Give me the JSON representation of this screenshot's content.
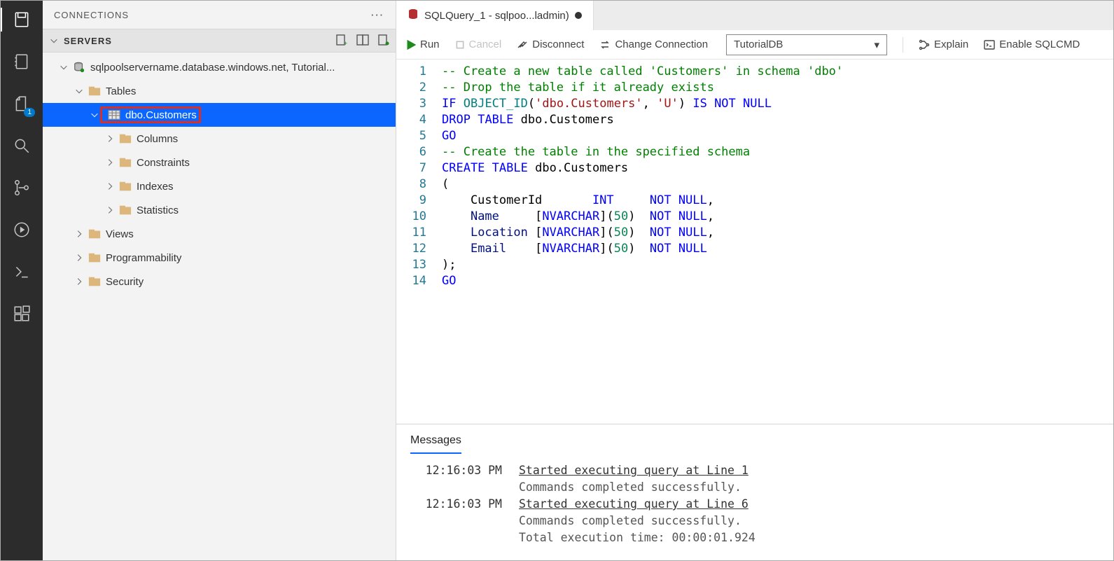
{
  "sidebar": {
    "title": "CONNECTIONS",
    "servers_label": "SERVERS",
    "tree": {
      "server": "sqlpoolservername.database.windows.net, Tutorial...",
      "tables": "Tables",
      "dbo_customers": "dbo.Customers",
      "columns": "Columns",
      "constraints": "Constraints",
      "indexes": "Indexes",
      "statistics": "Statistics",
      "views": "Views",
      "programmability": "Programmability",
      "security": "Security"
    }
  },
  "activity_badge": "1",
  "tab": {
    "title": "SQLQuery_1 - sqlpoo...ladmin)"
  },
  "toolbar": {
    "run": "Run",
    "cancel": "Cancel",
    "disconnect": "Disconnect",
    "change_conn": "Change Connection",
    "db_select": "TutorialDB",
    "explain": "Explain",
    "sqlcmd": "Enable SQLCMD"
  },
  "code": {
    "l1": "-- Create a new table called 'Customers' in schema 'dbo'",
    "l2": "-- Drop the table if it already exists",
    "l3a": "IF",
    "l3b": "OBJECT_ID",
    "l3c": "'dbo.Customers'",
    "l3d": "'U'",
    "l3e": "IS",
    "l3f": "NOT",
    "l3g": "NULL",
    "l4a": "DROP",
    "l4b": "TABLE",
    "l4c": " dbo.Customers",
    "l5": "GO",
    "l6": "-- Create the table in the specified schema",
    "l7a": "CREATE",
    "l7b": "TABLE",
    "l7c": " dbo.Customers",
    "l8": "(",
    "l9a": "    CustomerId       ",
    "l9b": "INT",
    "l9c": "NOT",
    "l9d": "NULL",
    "l10a": "    ",
    "l10n": "Name",
    "l10b": "     [",
    "l10c": "NVARCHAR",
    "l10d": "](",
    "l10e": "50",
    "l10f": ")  ",
    "l10g": "NOT",
    "l10h": "NULL",
    "l11n": "Location",
    "l11e": "50",
    "l12n": "Email",
    "l12e": "50",
    "l13": ");",
    "l14": "GO"
  },
  "lines": [
    "1",
    "2",
    "3",
    "4",
    "5",
    "6",
    "7",
    "8",
    "9",
    "10",
    "11",
    "12",
    "13",
    "14"
  ],
  "messages": {
    "tab": "Messages",
    "r1t": "12:16:03 PM",
    "r1a": "Started executing query at Line 1",
    "r1b": "Commands completed successfully.",
    "r2t": "12:16:03 PM",
    "r2a": "Started executing query at Line 6",
    "r2b": "Commands completed successfully.",
    "r2c": "Total execution time: 00:00:01.924"
  }
}
